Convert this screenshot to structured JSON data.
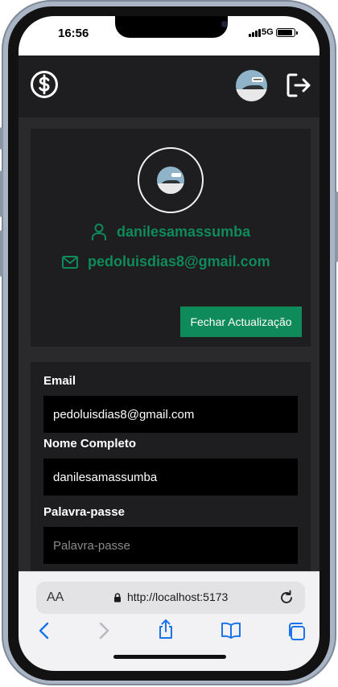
{
  "status_bar": {
    "time": "16:56",
    "network": "5G"
  },
  "app_bar": {
    "logo_icon": "dollar-circle-icon",
    "avatar_icon": "shoe-avatar",
    "logout_icon": "logout-icon"
  },
  "profile": {
    "username": "danilesamassumba",
    "email": "pedoluisdias8@gmail.com",
    "close_update_label": "Fechar Actualização"
  },
  "form": {
    "email_label": "Email",
    "email_value": "pedoluisdias8@gmail.com",
    "name_label": "Nome Completo",
    "name_value": "danilesamassumba",
    "password_label": "Palavra-passe",
    "password_placeholder": "Palavra-passe"
  },
  "browser": {
    "aa_label": "AA",
    "url": "http://localhost:5173"
  },
  "colors": {
    "accent": "#0f8a5b",
    "card_bg": "#1e1e20",
    "page_bg": "#2a2a2d",
    "input_bg": "#000000"
  }
}
